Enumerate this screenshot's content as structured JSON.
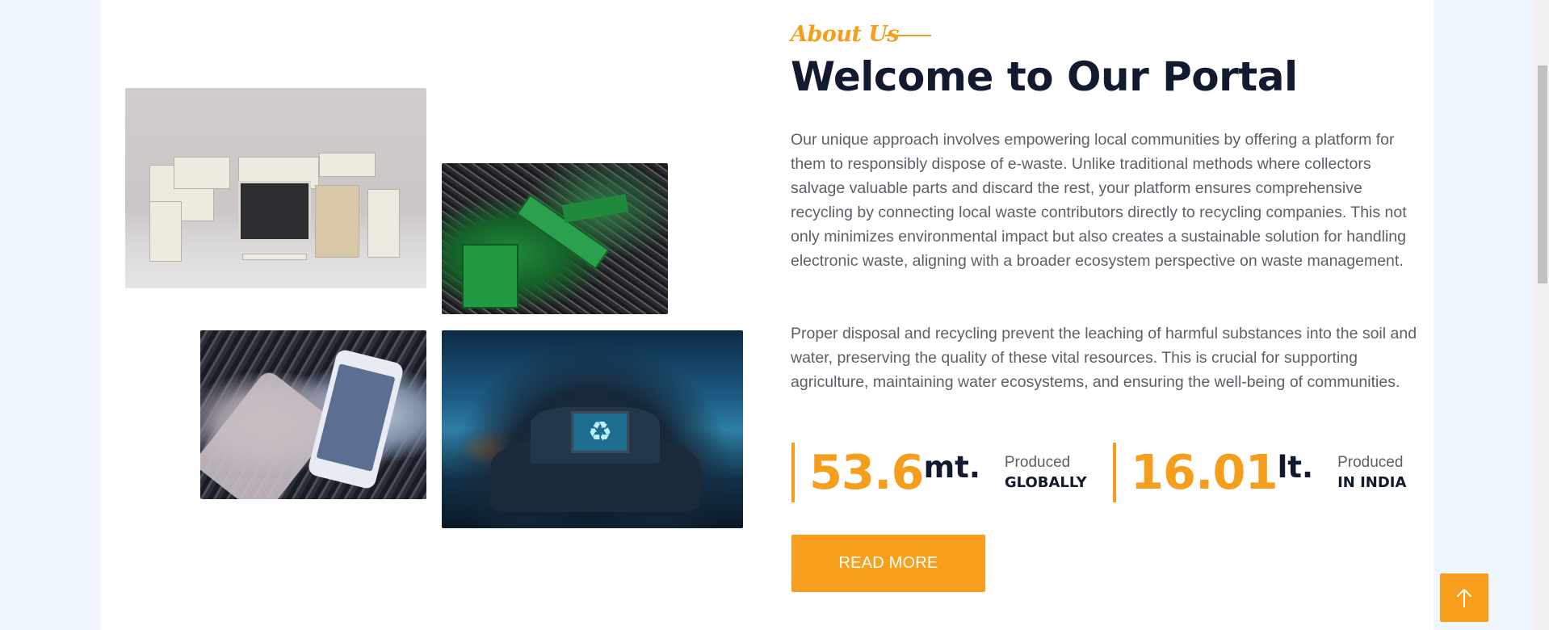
{
  "about": {
    "label": "About Us"
  },
  "title": "Welcome to Our Portal",
  "paragraphs": [
    "Our unique approach involves empowering local communities by offering a platform for them to responsibly dispose of e-waste. Unlike traditional methods where collectors salvage valuable parts and discard the rest, your platform ensures comprehensive recycling by connecting local waste contributors directly to recycling companies. This not only minimizes environmental impact but also creates a sustainable solution for handling electronic waste, aligning with a broader ecosystem perspective on waste management.",
    "Proper disposal and recycling prevent the leaching of harmful substances into the soil and water, preserving the quality of these vital resources. This is crucial for supporting agriculture, maintaining water ecosystems, and ensuring the well-being of communities."
  ],
  "stats": [
    {
      "number": "53.6",
      "unit": "mt.",
      "top": "Produced",
      "bottom": "GLOBALLY"
    },
    {
      "number": "16.01",
      "unit": "lt.",
      "top": "Produced",
      "bottom": "IN INDIA"
    }
  ],
  "buttons": {
    "read_more": "READ MORE"
  },
  "icons": {
    "back_to_top": "arrow-up-icon"
  },
  "colors": {
    "accent": "#f59e1c",
    "heading": "#111a2e",
    "body_text": "#5c5f66",
    "page_bg": "#f0f6fd"
  }
}
